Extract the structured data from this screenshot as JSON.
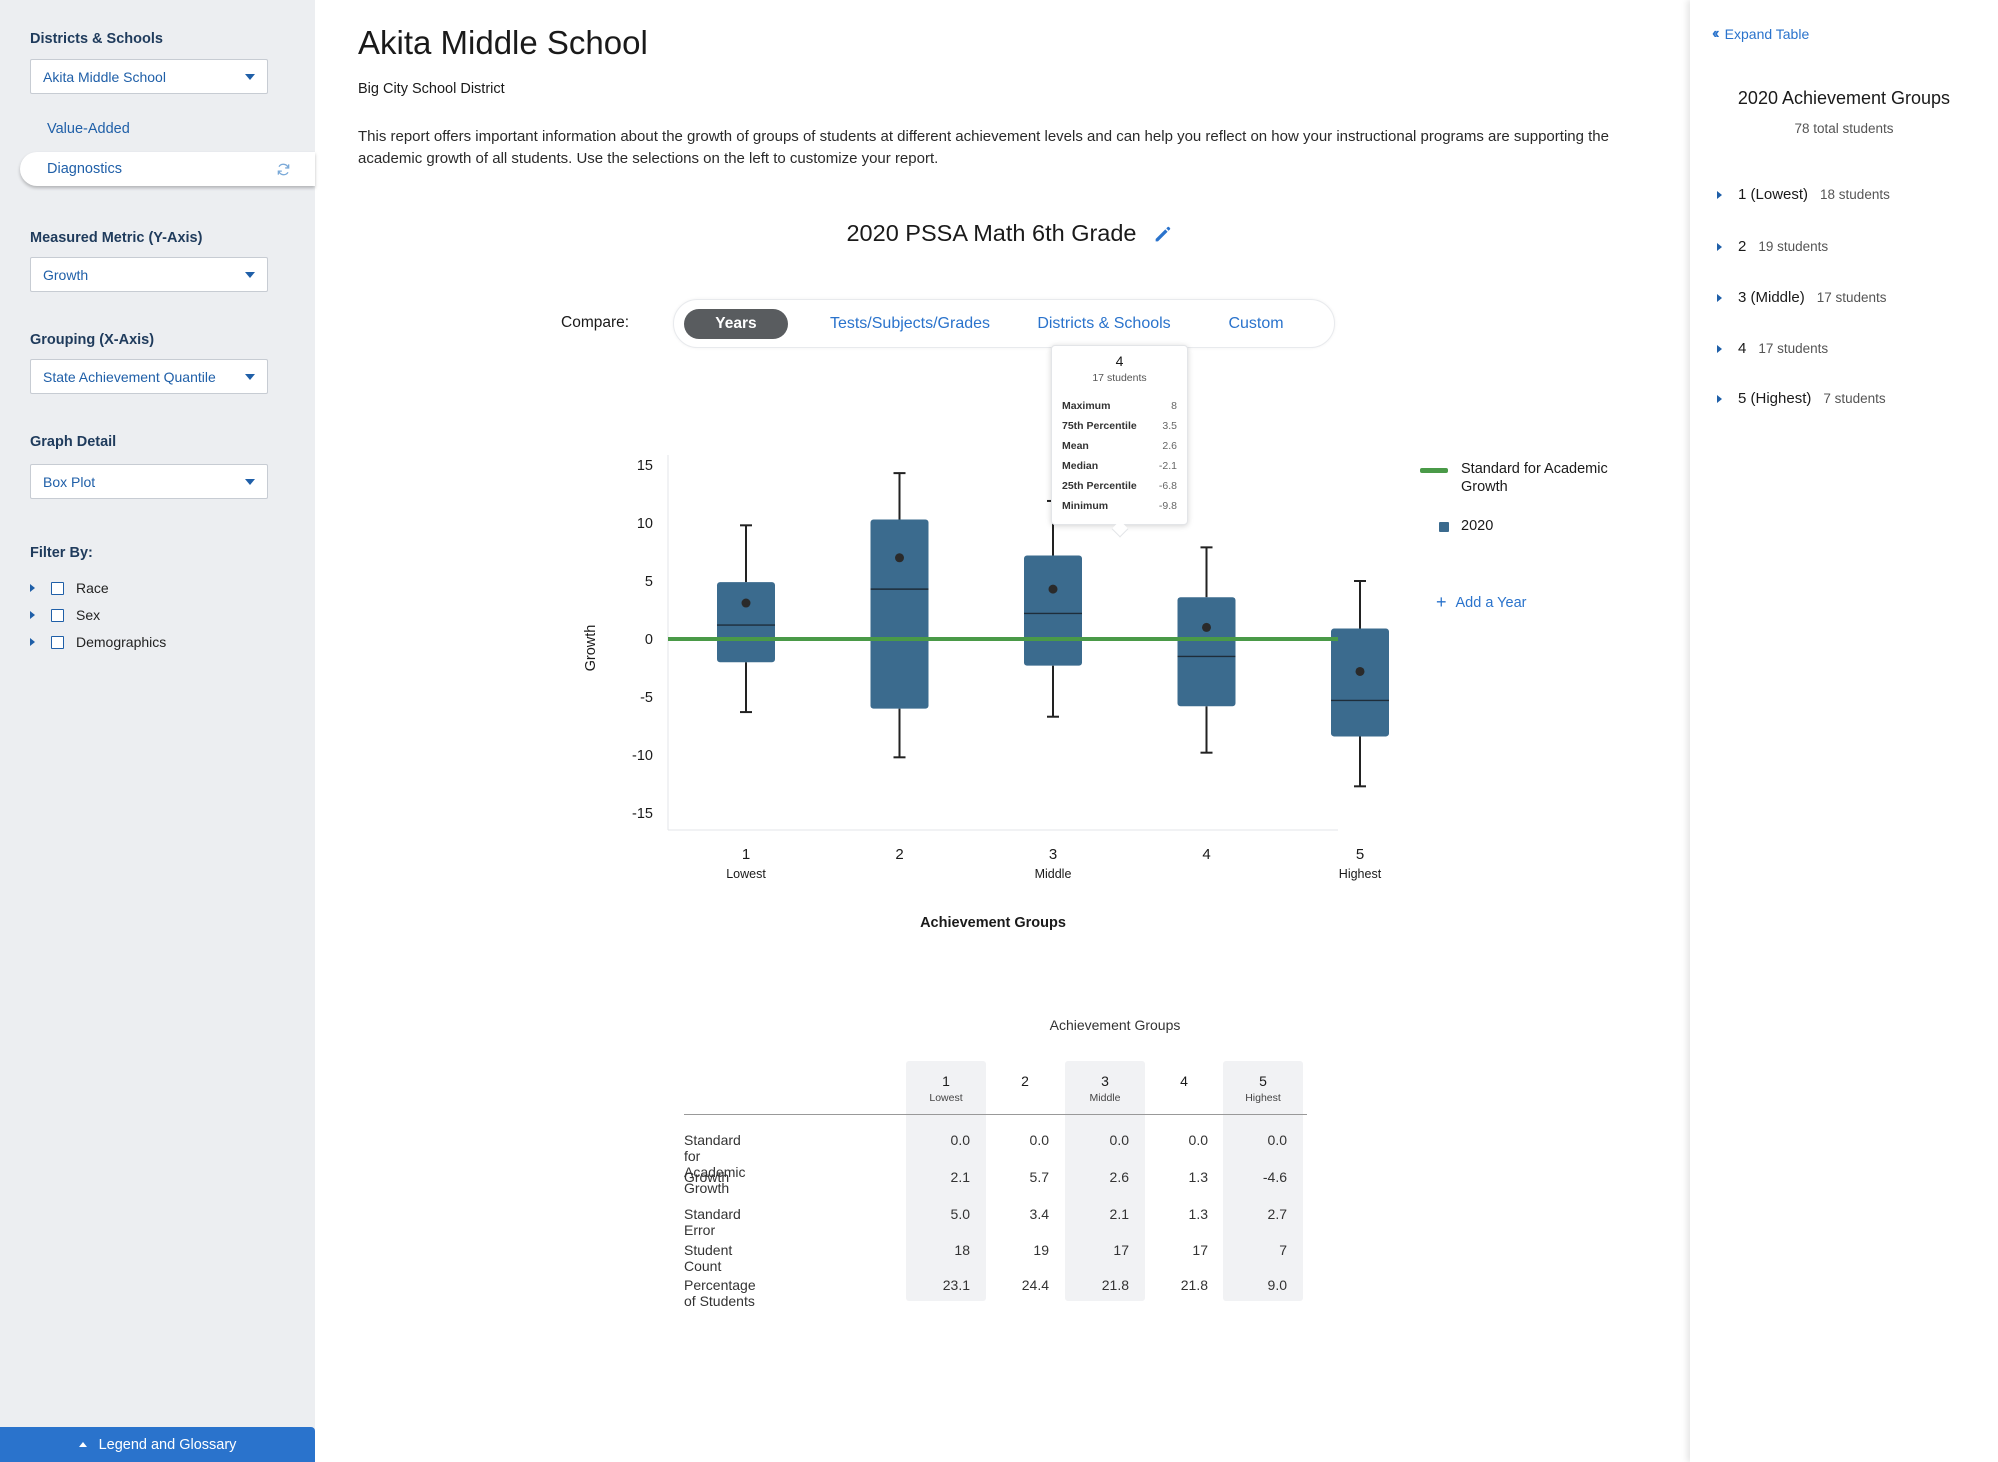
{
  "sidebar": {
    "districts_label": "Districts & Schools",
    "school_select": "Akita Middle School",
    "nav_value_added": "Value-Added",
    "nav_diagnostics": "Diagnostics",
    "metric_label": "Measured Metric (Y-Axis)",
    "metric_select": "Growth",
    "grouping_label": "Grouping (X-Axis)",
    "grouping_select": "State Achievement Quantile",
    "detail_label": "Graph Detail",
    "detail_select": "Box Plot",
    "filter_label": "Filter By:",
    "filters": [
      "Race",
      "Sex",
      "Demographics"
    ],
    "legend_button": "Legend and Glossary"
  },
  "main": {
    "title": "Akita Middle School",
    "district": "Big City School District",
    "description": "This report offers important information about the growth of groups of students at different achievement levels and can help you reflect on how your instructional programs are supporting the academic growth of all students. Use the selections on the left to customize your report.",
    "chart_title": "2020 PSSA Math 6th Grade",
    "compare_label": "Compare:",
    "compare_tabs": [
      "Years",
      "Tests/Subjects/Grades",
      "Districts & Schools",
      "Custom"
    ],
    "legend": {
      "standard": "Standard for Academic Growth",
      "year": "2020",
      "add_year": "Add a Year"
    },
    "tooltip": {
      "group": "4",
      "students": "17 students",
      "rows": [
        {
          "label": "Maximum",
          "value": "8"
        },
        {
          "label": "75th Percentile",
          "value": "3.5"
        },
        {
          "label": "Mean",
          "value": "2.6"
        },
        {
          "label": "Median",
          "value": "-2.1"
        },
        {
          "label": "25th Percentile",
          "value": "-6.8"
        },
        {
          "label": "Minimum",
          "value": "-9.8"
        }
      ]
    },
    "table": {
      "caption": "Achievement Groups",
      "columns": [
        {
          "num": "1",
          "sub": "Lowest"
        },
        {
          "num": "2",
          "sub": ""
        },
        {
          "num": "3",
          "sub": "Middle"
        },
        {
          "num": "4",
          "sub": ""
        },
        {
          "num": "5",
          "sub": "Highest"
        }
      ],
      "rows": [
        {
          "label": "Standard for Academic Growth",
          "values": [
            "0.0",
            "0.0",
            "0.0",
            "0.0",
            "0.0"
          ]
        },
        {
          "label": "Growth",
          "values": [
            "2.1",
            "5.7",
            "2.6",
            "1.3",
            "-4.6"
          ]
        },
        {
          "label": "Standard Error",
          "values": [
            "5.0",
            "3.4",
            "2.1",
            "1.3",
            "2.7"
          ]
        },
        {
          "label": "Student Count",
          "values": [
            "18",
            "19",
            "17",
            "17",
            "7"
          ]
        },
        {
          "label": "Percentage of Students",
          "values": [
            "23.1",
            "24.4",
            "21.8",
            "21.8",
            "9.0"
          ]
        }
      ]
    }
  },
  "right_panel": {
    "expand": "Expand Table",
    "title": "2020 Achievement Groups",
    "total": "78 total students",
    "groups": [
      {
        "name": "1 (Lowest)",
        "count": "18 students"
      },
      {
        "name": "2",
        "count": "19 students"
      },
      {
        "name": "3 (Middle)",
        "count": "17 students"
      },
      {
        "name": "4",
        "count": "17 students"
      },
      {
        "name": "5 (Highest)",
        "count": "7 students"
      }
    ]
  },
  "colors": {
    "box": "#3b6b8e",
    "standard_line": "#4a9a48",
    "accent": "#2a73cc"
  },
  "chart_data": {
    "type": "box",
    "xlabel": "Achievement Groups",
    "ylabel": "Growth",
    "ylim": [
      -15,
      15
    ],
    "yticks": [
      15,
      10,
      5,
      0,
      -5,
      -10,
      -15
    ],
    "categories": [
      {
        "label": "1",
        "sub": "Lowest"
      },
      {
        "label": "2",
        "sub": ""
      },
      {
        "label": "3",
        "sub": "Middle"
      },
      {
        "label": "4",
        "sub": ""
      },
      {
        "label": "5",
        "sub": "Highest"
      }
    ],
    "reference_line": 0,
    "series": [
      {
        "name": "2020",
        "boxes": [
          {
            "min": -6.3,
            "q1": -2.0,
            "median": 1.2,
            "q3": 4.9,
            "max": 9.8,
            "mean": 3.1
          },
          {
            "min": -10.2,
            "q1": -6.0,
            "median": 4.3,
            "q3": 10.3,
            "max": 14.3,
            "mean": 7.0
          },
          {
            "min": -6.7,
            "q1": -2.3,
            "median": 2.2,
            "q3": 7.2,
            "max": 11.9,
            "mean": 4.3
          },
          {
            "min": -9.8,
            "q1": -5.8,
            "median": -1.5,
            "q3": 3.6,
            "max": 7.9,
            "mean": 1.0
          },
          {
            "min": -12.7,
            "q1": -8.4,
            "median": -5.3,
            "q3": 0.9,
            "max": 5.0,
            "mean": -2.8
          }
        ]
      }
    ]
  }
}
